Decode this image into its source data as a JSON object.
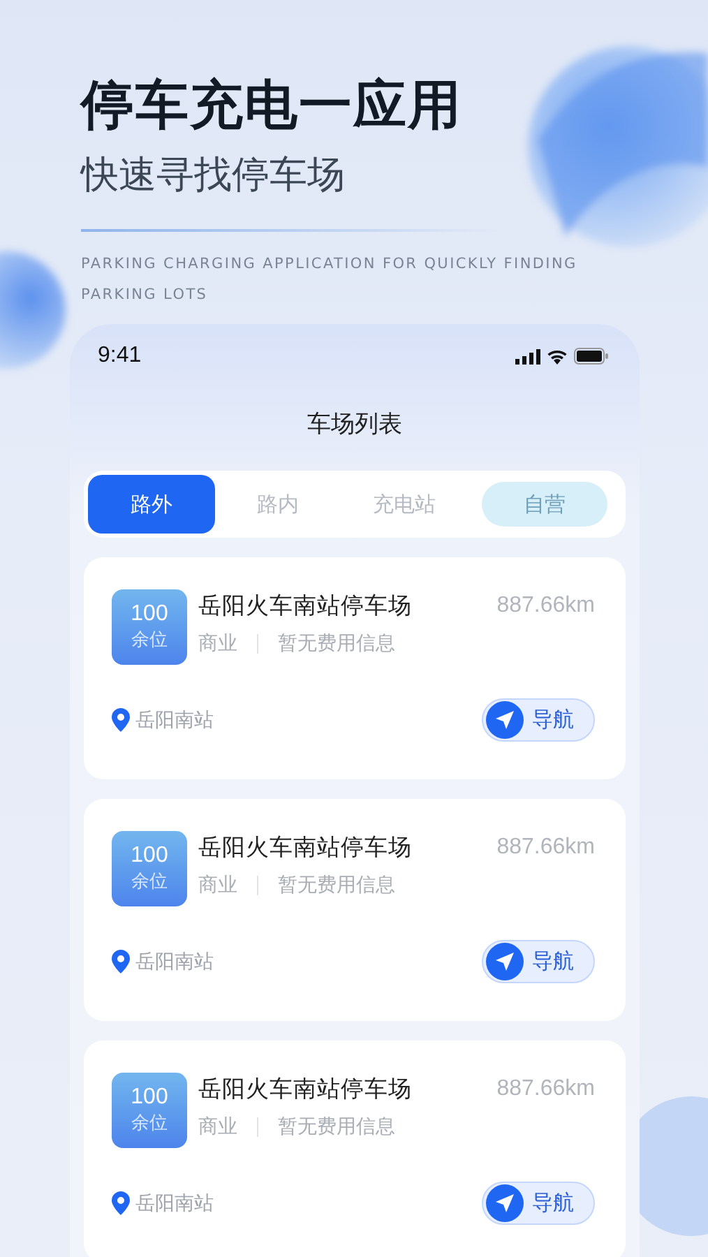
{
  "headline": "停车充电一应用",
  "subtitle": "快速寻找停车场",
  "tagline": "PARKING CHARGING APPLICATION FOR QUICKLY FINDING PARKING LOTS",
  "phone": {
    "status_bar": {
      "time": "9:41"
    },
    "title": "车场列表",
    "tabs": [
      {
        "label": "路外",
        "selected": true,
        "disabled": false
      },
      {
        "label": "路内",
        "selected": false,
        "disabled": false
      },
      {
        "label": "充电站",
        "selected": false,
        "disabled": false
      },
      {
        "label": "自营",
        "selected": false,
        "disabled": true
      }
    ],
    "lots": [
      {
        "spaces": "100",
        "spaces_label": "余位",
        "name": "岳阳火车南站停车场",
        "distance": "887.66km",
        "type": "商业",
        "fee": "暂无费用信息",
        "address": "岳阳南站",
        "nav_label": "导航"
      },
      {
        "spaces": "100",
        "spaces_label": "余位",
        "name": "岳阳火车南站停车场",
        "distance": "887.66km",
        "type": "商业",
        "fee": "暂无费用信息",
        "address": "岳阳南站",
        "nav_label": "导航"
      },
      {
        "spaces": "100",
        "spaces_label": "余位",
        "name": "岳阳火车南站停车场",
        "distance": "887.66km",
        "type": "商业",
        "fee": "暂无费用信息",
        "address": "岳阳南站",
        "nav_label": "导航"
      }
    ]
  }
}
